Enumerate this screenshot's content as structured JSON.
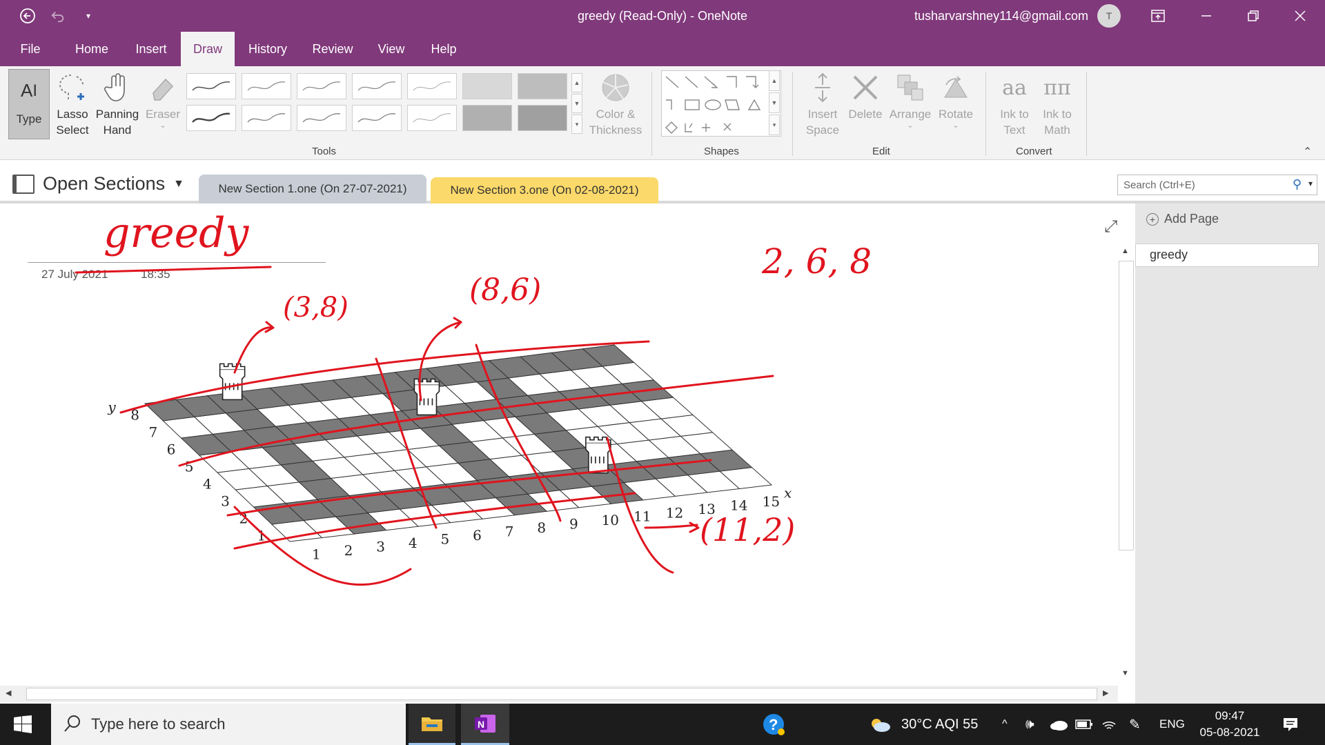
{
  "titlebar": {
    "title": "greedy (Read-Only)  -  OneNote",
    "user_email": "tusharvarshney114@gmail.com",
    "avatar_initial": "T",
    "back_icon": "back-arrow-icon",
    "undo_icon": "undo-icon",
    "qat_icon": "customize-quick-access-icon"
  },
  "menu": {
    "tabs": [
      "File",
      "Home",
      "Insert",
      "Draw",
      "History",
      "Review",
      "View",
      "Help"
    ],
    "active": "Draw"
  },
  "ribbon": {
    "tools": {
      "type": "Type",
      "lasso_1": "Lasso",
      "lasso_2": "Select",
      "pan_1": "Panning",
      "pan_2": "Hand",
      "eraser": "Eraser",
      "color_1": "Color &",
      "color_2": "Thickness",
      "label": "Tools"
    },
    "shapes": {
      "label": "Shapes"
    },
    "edit": {
      "insert_1": "Insert",
      "insert_2": "Space",
      "delete": "Delete",
      "arrange": "Arrange",
      "rotate": "Rotate",
      "label": "Edit"
    },
    "convert": {
      "ink_text_1": "Ink to",
      "ink_text_2": "Text",
      "ink_math_1": "Ink to",
      "ink_math_2": "Math",
      "label": "Convert"
    }
  },
  "sections": {
    "open_label": "Open Sections",
    "tabs": [
      {
        "label": "New Section 1.one (On 27-07-2021)",
        "color": "#c9ced6"
      },
      {
        "label": "New Section 3.one (On 02-08-2021)",
        "color": "#fbd96a"
      }
    ],
    "search_placeholder": "Search (Ctrl+E)"
  },
  "page": {
    "date": "27 July 2021",
    "time": "18:35",
    "ink_title": "greedy",
    "ink_notes": [
      "(3,8)",
      "(8,6)",
      "(11,2)",
      "2, 6, 8"
    ],
    "board": {
      "y_axis_label": "y",
      "x_axis_label": "x",
      "x_ticks": [
        "1",
        "2",
        "3",
        "4",
        "5",
        "6",
        "7",
        "8",
        "9",
        "10",
        "11",
        "12",
        "13",
        "14",
        "15"
      ],
      "y_ticks": [
        "1",
        "2",
        "3",
        "4",
        "5",
        "6",
        "7",
        "8"
      ],
      "rooks": [
        [
          3,
          8
        ],
        [
          8,
          6
        ],
        [
          11,
          2
        ]
      ]
    }
  },
  "pages_panel": {
    "add_page": "Add Page",
    "pages": [
      "greedy"
    ]
  },
  "taskbar": {
    "search_placeholder": "Type here to search",
    "weather": "30°C  AQI 55",
    "language": "ENG",
    "time": "09:47",
    "date": "05-08-2021"
  },
  "colors": {
    "brand": "#80397b",
    "ink": "#e0141e"
  }
}
